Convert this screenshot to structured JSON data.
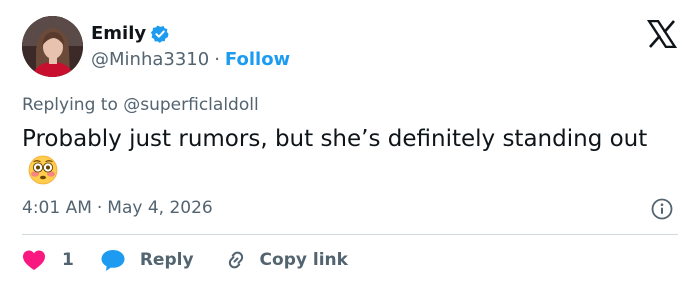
{
  "author": {
    "display_name": "Emily",
    "handle": "@Minha3310",
    "separator": "·",
    "follow_label": "Follow",
    "verified": true,
    "verified_color": "#1d9bf0"
  },
  "reply_context": {
    "prefix": "Replying to",
    "mention": "@superficlaldoll"
  },
  "tweet": {
    "text": "Probably just rumors, but she’s definitely standing out",
    "emoji": "flushed-face-emoji"
  },
  "meta": {
    "time": "4:01 AM",
    "separator": "·",
    "date": "May 4, 2026"
  },
  "actions": {
    "like_count": "1",
    "reply_label": "Reply",
    "copy_link_label": "Copy link"
  },
  "colors": {
    "text_primary": "#0f1419",
    "text_secondary": "#536471",
    "accent": "#1d9bf0",
    "like": "#f91880",
    "divider": "#cfd9de"
  }
}
